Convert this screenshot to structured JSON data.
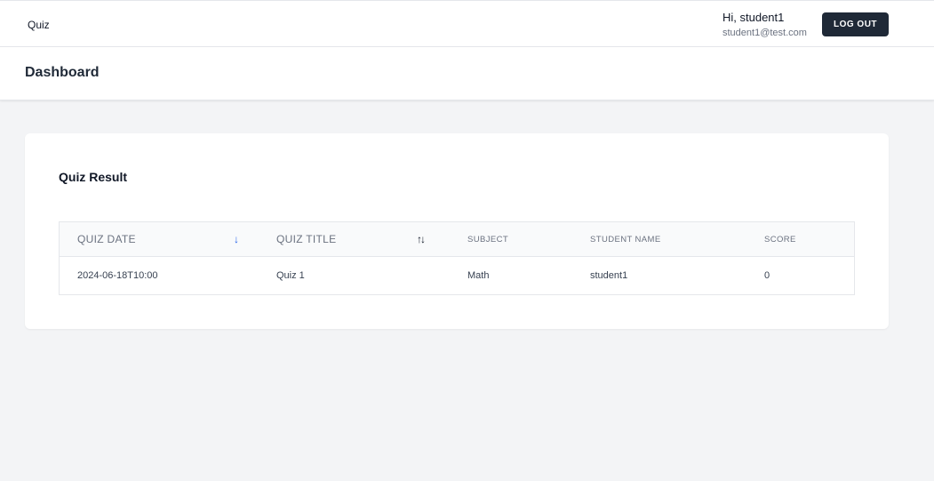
{
  "app": {
    "brand": "Quiz"
  },
  "user": {
    "greeting": "Hi, student1",
    "email": "student1@test.com"
  },
  "actions": {
    "logout_label": "LOG OUT"
  },
  "page": {
    "title": "Dashboard"
  },
  "quiz_result": {
    "title": "Quiz Result",
    "columns": {
      "quiz_date": "QUIZ DATE",
      "quiz_title": "QUIZ TITLE",
      "subject": "SUBJECT",
      "student_name": "STUDENT NAME",
      "score": "SCORE"
    },
    "sort": {
      "quiz_date": "descending",
      "quiz_title": "unsorted"
    },
    "rows": [
      {
        "quiz_date": "2024-06-18T10:00",
        "quiz_title": "Quiz 1",
        "subject": "Math",
        "student_name": "student1",
        "score": "0"
      }
    ]
  },
  "colors": {
    "primary_button": "#1f2937",
    "page_background": "#f3f4f6",
    "active_sort": "#2563eb"
  }
}
